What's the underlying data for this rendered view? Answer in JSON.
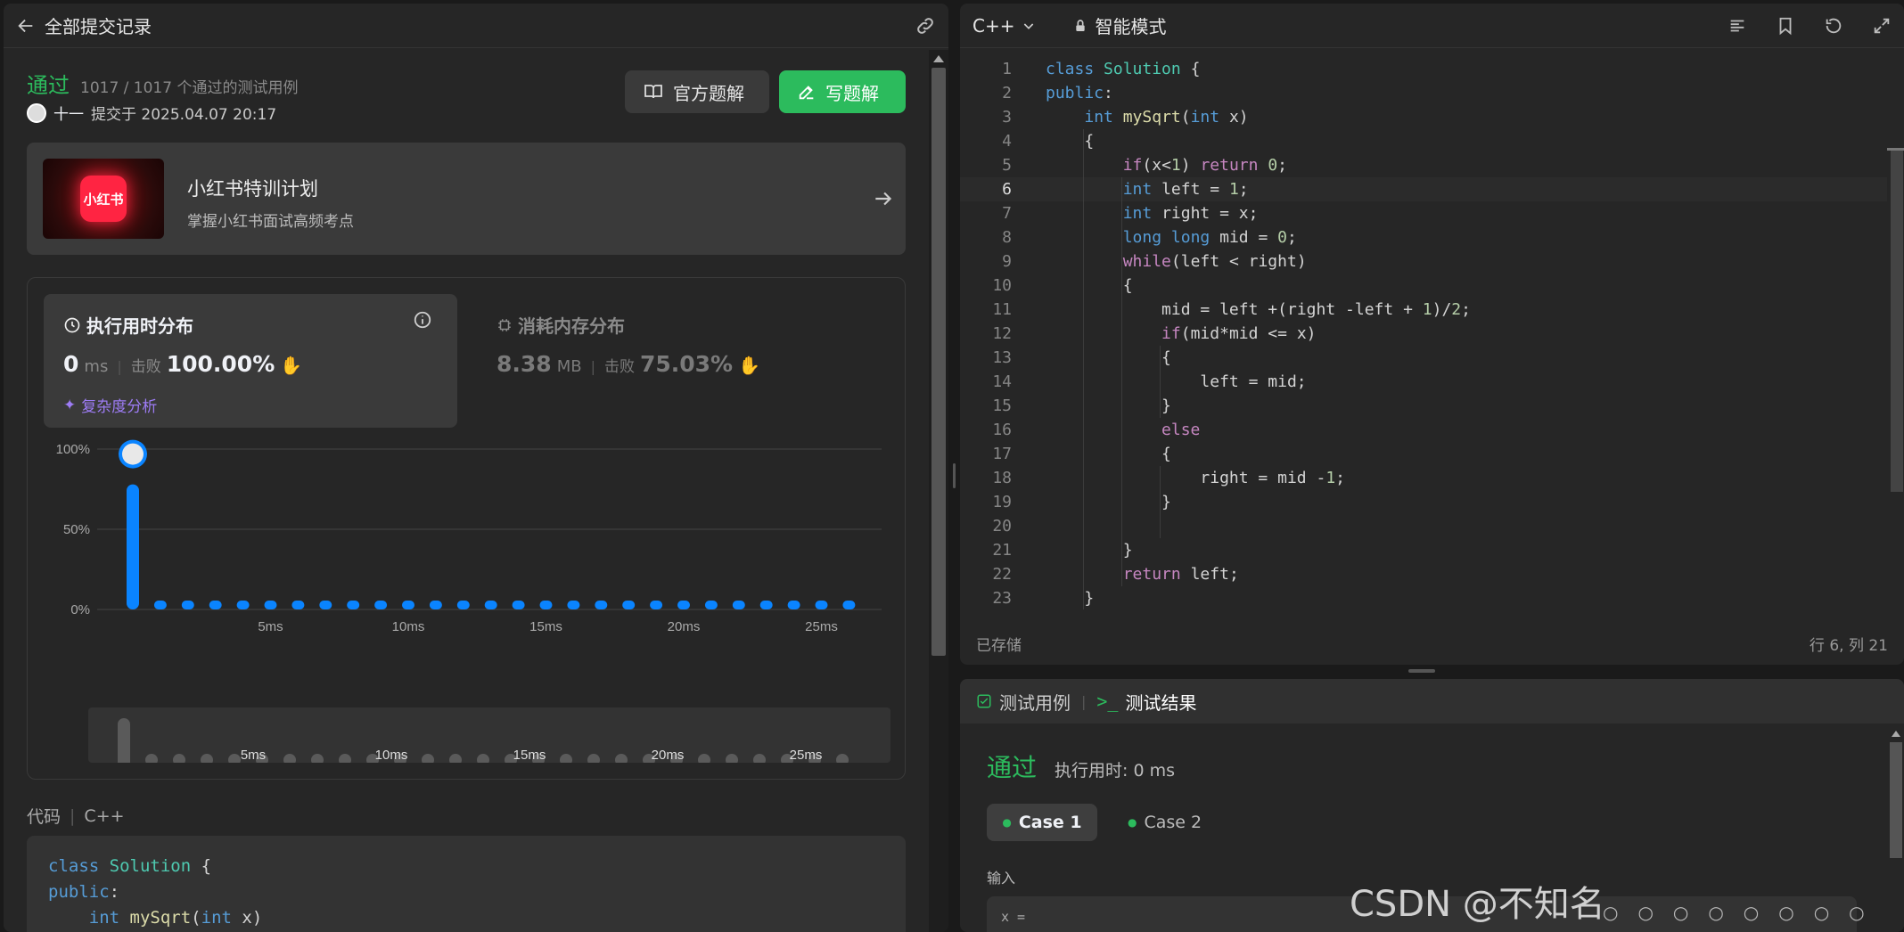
{
  "left": {
    "header_title": "全部提交记录",
    "status": "通过",
    "testcases": "1017 / 1017 个通过的测试用例",
    "user": "十一",
    "submitted_at": "提交于 2025.04.07 20:17",
    "official_solution": "官方题解",
    "write_solution": "写题解",
    "promo_logo": "小红书",
    "promo_title": "小红书特训计划",
    "promo_sub": "掌握小红书面试高频考点",
    "runtime_title": "执行用时分布",
    "runtime_value": "0",
    "runtime_unit": "ms",
    "beats_label": "击败",
    "runtime_beats": "100.00%",
    "complexity": "复杂度分析",
    "memory_title": "消耗内存分布",
    "memory_value": "8.38",
    "memory_unit": "MB",
    "memory_beats": "75.03%",
    "code_label": "代码",
    "code_lang": "C++",
    "preview_lines": [
      "class Solution {",
      "public:",
      "    int mySqrt(int x)"
    ]
  },
  "chart_data": {
    "type": "bar",
    "x": [
      0,
      1,
      2,
      3,
      4,
      5,
      6,
      7,
      8,
      9,
      10,
      11,
      12,
      13,
      14,
      15,
      16,
      17,
      18,
      19,
      20,
      21,
      22,
      23,
      24,
      25,
      26
    ],
    "values": [
      78,
      1,
      1,
      2,
      1,
      1,
      1,
      1,
      1,
      1,
      1,
      1,
      1,
      1,
      1,
      1,
      1,
      1,
      1,
      1,
      1,
      1,
      1,
      1,
      1,
      1,
      1
    ],
    "xticks": [
      "5ms",
      "10ms",
      "15ms",
      "20ms",
      "25ms"
    ],
    "yticks": [
      "100%",
      "50%",
      "0%"
    ],
    "ylim": [
      0,
      100
    ],
    "color": "#0a84ff"
  },
  "editor": {
    "lang": "C++",
    "mode": "智能模式",
    "saved": "已存储",
    "cursor": "行 6, 列 21",
    "active_line": 6
  },
  "code": [
    "class Solution {",
    "public:",
    "    int mySqrt(int x)",
    "    {",
    "        if(x<1) return 0;",
    "        int left = 1;",
    "        int right = x;",
    "        long long mid = 0;",
    "        while(left < right)",
    "        {",
    "            mid = left +(right -left + 1)/2;",
    "            if(mid*mid <= x)",
    "            {",
    "                left = mid;",
    "            }",
    "            else",
    "            {",
    "                right = mid -1;",
    "            }",
    "",
    "        }",
    "        return left;",
    "    }"
  ],
  "result": {
    "tab_testcase": "测试用例",
    "tab_result": "测试结果",
    "status": "通过",
    "runtime": "执行用时: 0 ms",
    "case1": "Case 1",
    "case2": "Case 2",
    "input_label": "输入",
    "input_var": "x ="
  },
  "watermark": "CSDN @不知名"
}
